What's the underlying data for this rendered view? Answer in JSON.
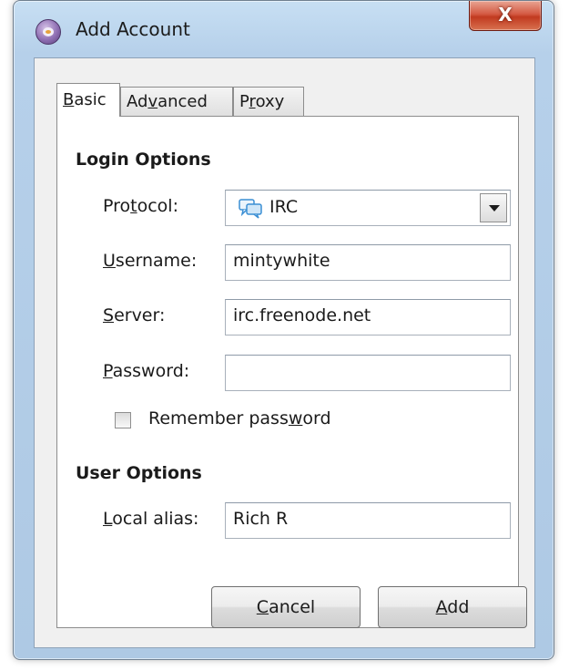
{
  "window": {
    "title": "Add Account",
    "close_label": "X"
  },
  "tabs": [
    {
      "label": "Basic",
      "active": true
    },
    {
      "label": "Advanced",
      "active": false
    },
    {
      "label": "Proxy",
      "active": false
    }
  ],
  "login_options": {
    "heading": "Login Options",
    "protocol_label": "Protocol:",
    "protocol_value": "IRC",
    "username_label": "Username:",
    "username_value": "mintywhite",
    "server_label": "Server:",
    "server_value": "irc.freenode.net",
    "password_label": "Password:",
    "password_value": "",
    "remember_label": "Remember password",
    "remember_checked": false
  },
  "user_options": {
    "heading": "User Options",
    "alias_label": "Local alias:",
    "alias_value": "Rich R"
  },
  "buttons": {
    "cancel": "Cancel",
    "add": "Add"
  },
  "colors": {
    "close_button": "#c13a20",
    "titlebar": "#b6d0ea",
    "accent_icon": "#3b8fd4"
  }
}
